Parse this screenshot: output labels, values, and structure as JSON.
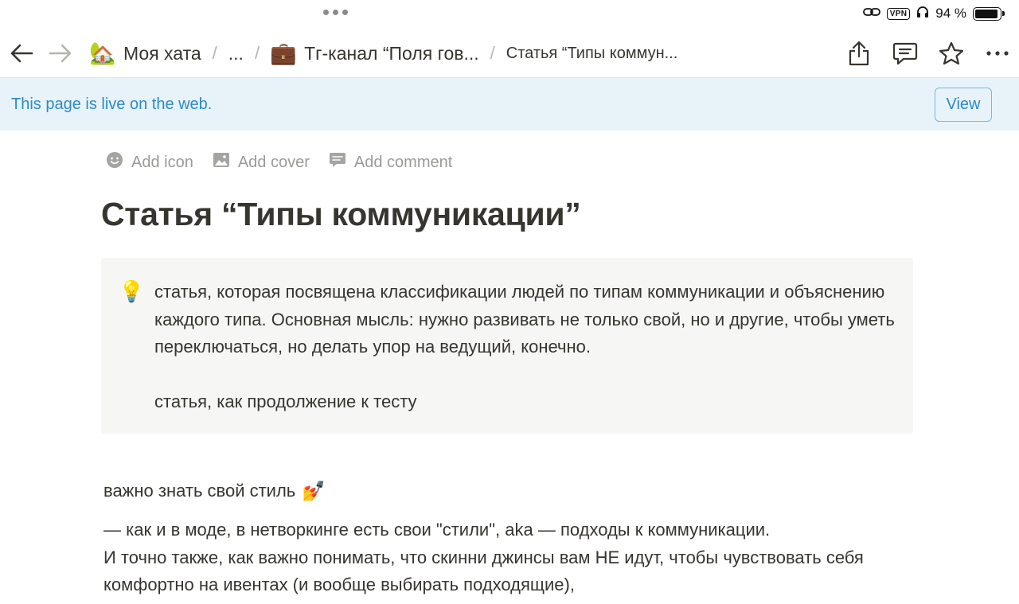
{
  "status_bar": {
    "vpn": "VPN",
    "battery_text": "94 %",
    "battery_level": 0.94
  },
  "nav": {
    "breadcrumbs": [
      {
        "emoji": "🏡",
        "label": "Моя хата"
      },
      {
        "label": "..."
      },
      {
        "emoji": "💼",
        "label": "Тг-канал “Поля гов..."
      },
      {
        "label": "Статья “Типы коммун..."
      }
    ],
    "separator": "/"
  },
  "banner": {
    "text": "This page is live on the web.",
    "view_label": "View"
  },
  "page_actions": {
    "add_icon": "Add icon",
    "add_cover": "Add cover",
    "add_comment": "Add comment"
  },
  "page": {
    "title": "Статья “Типы коммуникации”",
    "callout": {
      "icon": "💡",
      "paragraph1": "статья, которая посвящена классификации людей по типам коммуникации и объяснению каждого типа. Основная мысль: нужно развивать не только свой, но и другие, чтобы уметь переключаться, но делать упор на ведущий, конечно.",
      "paragraph2": "статья, как продолжение к тесту"
    },
    "section_heading": "важно знать свой стиль",
    "section_emoji": "💅",
    "body_line1": "— как и в моде, в нетворкинге есть свои \"стили\", aka — подходы к коммуникации.",
    "body_line2": "И точно также, как важно понимать, что скинни джинсы вам НЕ идут, чтобы чувствовать себя комфортно на ивентах (и вообще выбирать подходящие),"
  },
  "colors": {
    "banner_bg": "#e7f3f8",
    "link_blue": "#2d8ac7",
    "text": "#37352f",
    "muted": "#9b9a97",
    "callout_bg": "#f6f6f5"
  }
}
